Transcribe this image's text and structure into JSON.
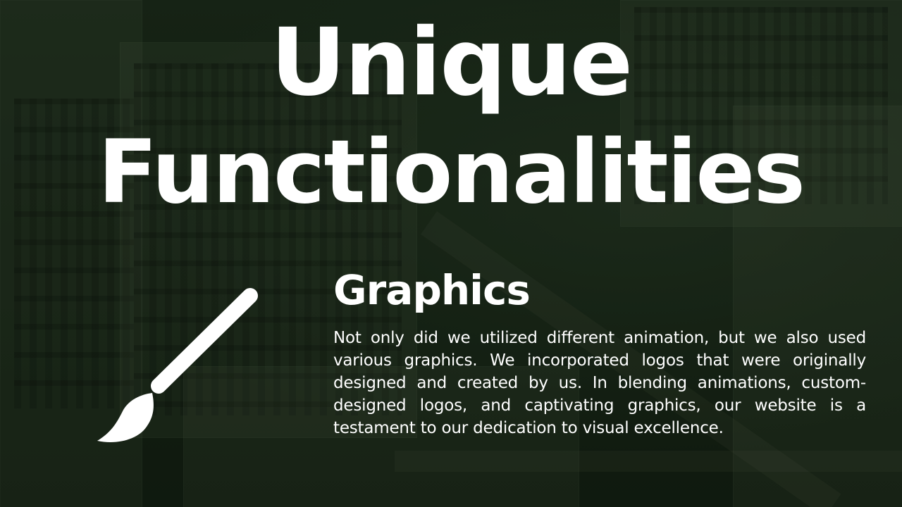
{
  "slide": {
    "title_line1": "Unique",
    "title_line2": "Functionalities",
    "background": "dimmed aerial photo of campus buildings with green tint"
  },
  "feature": {
    "icon": "paintbrush-icon",
    "heading": "Graphics",
    "body": "Not only did we utilized different animation, but we also used various graphics. We incorporated logos that were originally designed and created by us. In blending animations, custom-designed logos, and captivating graphics, our website is a testament to our dedication to visual excellence."
  },
  "colors": {
    "text": "#ffffff",
    "background_tint": "#172416"
  }
}
